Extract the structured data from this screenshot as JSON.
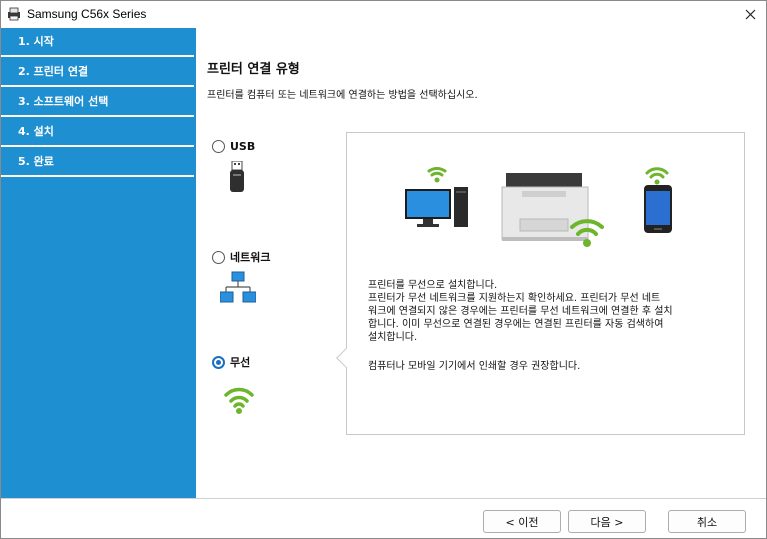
{
  "window": {
    "title": "Samsung C56x Series"
  },
  "sidebar": {
    "steps": [
      {
        "label": "1. 시작"
      },
      {
        "label": "2. 프린터 연결"
      },
      {
        "label": "3. 소프트웨어 선택"
      },
      {
        "label": "4. 설치"
      },
      {
        "label": "5. 완료"
      }
    ]
  },
  "main": {
    "heading": "프린터 연결 유형",
    "subtext": "프린터를 컴퓨터 또는 네트워크에 연결하는 방법을 선택하십시오.",
    "options": [
      {
        "label": "USB",
        "selected": false,
        "icon": "usb-icon"
      },
      {
        "label": "네트워크",
        "selected": false,
        "icon": "network-icon"
      },
      {
        "label": "무선",
        "selected": true,
        "icon": "wifi-icon"
      }
    ],
    "description_lines": [
      "프린터를 무선으로 설치합니다.",
      "프린터가 무선 네트워크를 지원하는지 확인하세요.  프린터가 무선 네트",
      "워크에 연결되지 않은 경우에는 프린터를 무선 네트워크에 연결한 후 설치",
      "합니다. 이미 무선으로 연결된 경우에는 연결된 프린터를 자동 검색하여",
      "설치합니다."
    ],
    "recommendation": "컴퓨터나 모바일 기기에서 인쇄할 경우 권장합니다."
  },
  "footer": {
    "back_label": "< 이전",
    "next_label": "다음 >",
    "cancel_label": "취소"
  },
  "colors": {
    "sidebar": "#1e8fd0",
    "wifi_green": "#6cb52d",
    "radio_selected": "#1a6fc0"
  }
}
